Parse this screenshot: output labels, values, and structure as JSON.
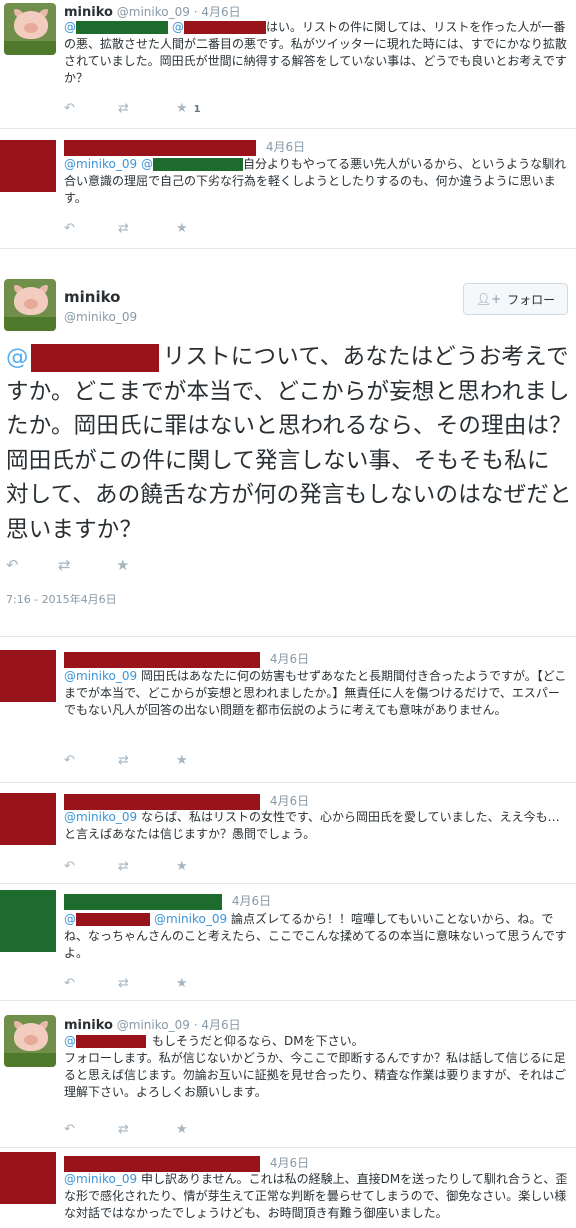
{
  "tweets": [
    {
      "name": "miniko",
      "handle": "@miniko_09",
      "sep": "·",
      "time": "4月6日",
      "at": "@",
      "text": "はい。リストの件に関しては、リストを作った人が一番の悪、拡散させた人間が二番目の悪です。私がツイッターに現れた時には、すでにかなり拡散されていました。岡田氏が世間に納得する解答をしていない事は、どうでも良いとお考えですか？",
      "favorite_count": "1"
    },
    {
      "time": "4月6日",
      "mention": "@miniko_09",
      "at": "@",
      "text": "自分よりもやってる悪い先人がいるから、というような馴れ合い意識の理屈で自己の下劣な行為を軽くしようとしたりするのも、何か違うように思います。"
    },
    {
      "mention": "@miniko_09",
      "text": "岡田氏はあなたに何の妨害もせずあなたと長期間付き合ったようですが。【どこまでが本当で、どこからが妄想と思われましたか。】無責任に人を傷つけるだけで、エスパーでもない凡人が回答の出ない問題を都市伝説のように考えても意味がありません。",
      "time": "4月6日"
    },
    {
      "mention": "@miniko_09",
      "text": "ならば、私はリストの女性です、心から岡田氏を愛していました、ええ今も…と言えばあなたは信じますか？愚問でしょう。",
      "time": "4月6日"
    },
    {
      "at": "@",
      "mention": "@miniko_09",
      "text": "論点ズレてるから！！喧嘩してもいいことないから、ね。でね、なっちゃんさんのこと考えたら、ここでこんな揉めてるの本当に意味ないって思うんですよ。",
      "time": "4月6日"
    },
    {
      "name": "miniko",
      "handle": "@miniko_09",
      "sep": "·",
      "time": "4月6日",
      "at": "@",
      "text_first": "もしそうだと仰るなら、DMを下さい。",
      "text": "フォローします。私が信じないかどうか、今ここで即断するんですか？私は話して信じるに足ると思えば信じます。勿論お互いに証拠を見せ合ったり、精査な作業は要りますが、それはご理解下さい。よろしくお願いします。"
    },
    {
      "mention": "@miniko_09",
      "text": "申し訳ありません。これは私の経験上、直接DMを送ったりして馴れ合うと、歪な形で感化されたり、情が芽生えて正常な判断を曇らせてしまうので、御免なさい。楽しい様な対話ではなかったでしょうけども、お時間頂き有難う御座いました。",
      "time": "4月6日"
    }
  ],
  "main_tweet": {
    "name": "miniko",
    "handle": "@miniko_09",
    "follow_label": "フォロー",
    "at": "@",
    "text": "リストについて、あなたはどうお考えですか。どこまでが本当で、どこからが妄想と思われましたか。岡田氏に罪はないと思われるなら、その理由は？岡田氏がこの件に関して発言しない事、そもそも私に対して、あの饒舌な方が何の発言もしないのはなぜだと思いますか？",
    "timestamp": "7:16 - 2015年4月6日"
  },
  "icons": {
    "reply": "reply-icon",
    "retweet": "retweet-icon",
    "favorite": "star-icon",
    "follow": "add-user-icon"
  },
  "colors": {
    "link": "#3b94d9",
    "redaction_red": "#99141a",
    "redaction_green": "#1e6b2e",
    "muted": "#8899a6"
  }
}
